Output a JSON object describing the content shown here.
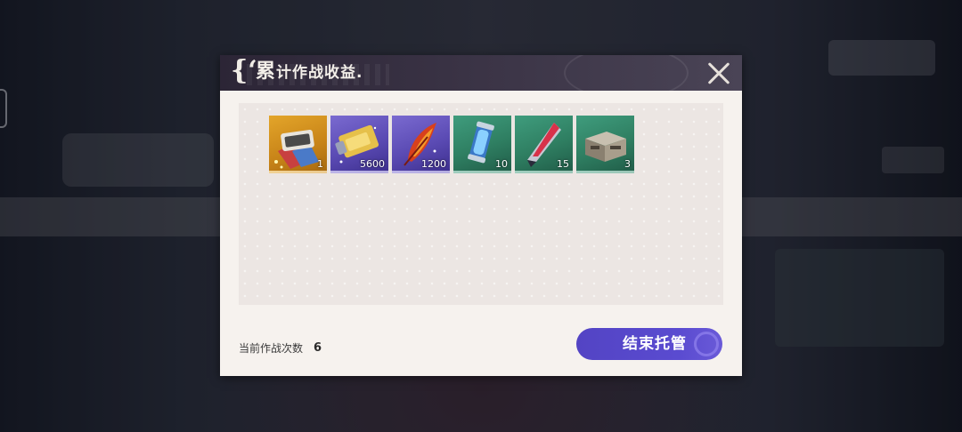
{
  "dialog": {
    "title_open": "{‘",
    "title_first": "累",
    "title_rest": "计作战收益.",
    "close_icon": "close-x-icon"
  },
  "rewards": [
    {
      "icon": "card-pack-icon",
      "quantity": "1",
      "rarity": "gold"
    },
    {
      "icon": "gold-ticket-icon",
      "quantity": "5600",
      "rarity": "purple"
    },
    {
      "icon": "flame-feather-icon",
      "quantity": "1200",
      "rarity": "purple"
    },
    {
      "icon": "energy-capsule-icon",
      "quantity": "10",
      "rarity": "green"
    },
    {
      "icon": "crystal-shard-icon",
      "quantity": "15",
      "rarity": "green"
    },
    {
      "icon": "supply-crate-icon",
      "quantity": "3",
      "rarity": "green"
    }
  ],
  "battle_count": {
    "label": "当前作战次数",
    "value": "6"
  },
  "end_button": {
    "label": "结束托管"
  },
  "colors": {
    "button": "#5344c4",
    "header": "#2c2536",
    "dialog_bg": "#f6f2ee",
    "gold": "#e3a52a",
    "purple": "#6a5ad0",
    "green": "#2f7f62"
  }
}
